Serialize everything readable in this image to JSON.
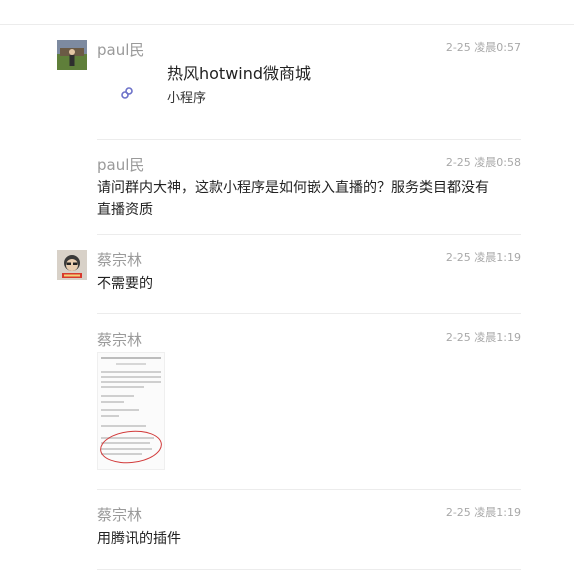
{
  "messages": [
    {
      "name": "paul民",
      "time": "2-25 凌晨0:57",
      "mini_program": {
        "title": "热风hotwind微商城",
        "subtitle": "小程序",
        "icon": "link-icon"
      }
    },
    {
      "name": "paul民",
      "time": "2-25 凌晨0:58",
      "text": "请问群内大神，这款小程序是如何嵌入直播的？服务类目都没有直播资质"
    },
    {
      "name": "蔡宗林",
      "time": "2-25 凌晨1:19",
      "text": "不需要的"
    },
    {
      "name": "蔡宗林",
      "time": "2-25 凌晨1:19",
      "image": "screenshot-thumbnail"
    },
    {
      "name": "蔡宗林",
      "time": "2-25 凌晨1:19",
      "text": "用腾讯的插件"
    }
  ],
  "colors": {
    "divider": "#ececec",
    "meta": "#9a9a9a",
    "text": "#222222",
    "annotation_ring": "#d23b3b"
  }
}
